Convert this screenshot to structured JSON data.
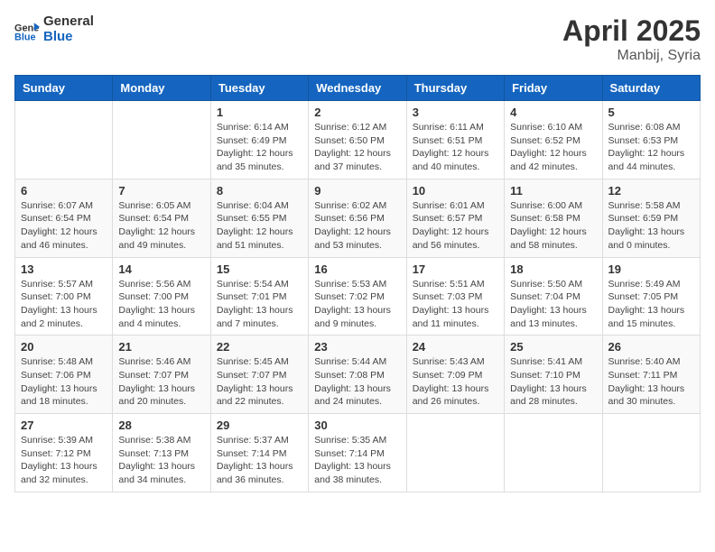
{
  "header": {
    "logo_general": "General",
    "logo_blue": "Blue",
    "title": "April 2025",
    "subtitle": "Manbij, Syria"
  },
  "calendar": {
    "days_of_week": [
      "Sunday",
      "Monday",
      "Tuesday",
      "Wednesday",
      "Thursday",
      "Friday",
      "Saturday"
    ],
    "weeks": [
      [
        {
          "day": "",
          "content": ""
        },
        {
          "day": "",
          "content": ""
        },
        {
          "day": "1",
          "content": "Sunrise: 6:14 AM\nSunset: 6:49 PM\nDaylight: 12 hours and 35 minutes."
        },
        {
          "day": "2",
          "content": "Sunrise: 6:12 AM\nSunset: 6:50 PM\nDaylight: 12 hours and 37 minutes."
        },
        {
          "day": "3",
          "content": "Sunrise: 6:11 AM\nSunset: 6:51 PM\nDaylight: 12 hours and 40 minutes."
        },
        {
          "day": "4",
          "content": "Sunrise: 6:10 AM\nSunset: 6:52 PM\nDaylight: 12 hours and 42 minutes."
        },
        {
          "day": "5",
          "content": "Sunrise: 6:08 AM\nSunset: 6:53 PM\nDaylight: 12 hours and 44 minutes."
        }
      ],
      [
        {
          "day": "6",
          "content": "Sunrise: 6:07 AM\nSunset: 6:54 PM\nDaylight: 12 hours and 46 minutes."
        },
        {
          "day": "7",
          "content": "Sunrise: 6:05 AM\nSunset: 6:54 PM\nDaylight: 12 hours and 49 minutes."
        },
        {
          "day": "8",
          "content": "Sunrise: 6:04 AM\nSunset: 6:55 PM\nDaylight: 12 hours and 51 minutes."
        },
        {
          "day": "9",
          "content": "Sunrise: 6:02 AM\nSunset: 6:56 PM\nDaylight: 12 hours and 53 minutes."
        },
        {
          "day": "10",
          "content": "Sunrise: 6:01 AM\nSunset: 6:57 PM\nDaylight: 12 hours and 56 minutes."
        },
        {
          "day": "11",
          "content": "Sunrise: 6:00 AM\nSunset: 6:58 PM\nDaylight: 12 hours and 58 minutes."
        },
        {
          "day": "12",
          "content": "Sunrise: 5:58 AM\nSunset: 6:59 PM\nDaylight: 13 hours and 0 minutes."
        }
      ],
      [
        {
          "day": "13",
          "content": "Sunrise: 5:57 AM\nSunset: 7:00 PM\nDaylight: 13 hours and 2 minutes."
        },
        {
          "day": "14",
          "content": "Sunrise: 5:56 AM\nSunset: 7:00 PM\nDaylight: 13 hours and 4 minutes."
        },
        {
          "day": "15",
          "content": "Sunrise: 5:54 AM\nSunset: 7:01 PM\nDaylight: 13 hours and 7 minutes."
        },
        {
          "day": "16",
          "content": "Sunrise: 5:53 AM\nSunset: 7:02 PM\nDaylight: 13 hours and 9 minutes."
        },
        {
          "day": "17",
          "content": "Sunrise: 5:51 AM\nSunset: 7:03 PM\nDaylight: 13 hours and 11 minutes."
        },
        {
          "day": "18",
          "content": "Sunrise: 5:50 AM\nSunset: 7:04 PM\nDaylight: 13 hours and 13 minutes."
        },
        {
          "day": "19",
          "content": "Sunrise: 5:49 AM\nSunset: 7:05 PM\nDaylight: 13 hours and 15 minutes."
        }
      ],
      [
        {
          "day": "20",
          "content": "Sunrise: 5:48 AM\nSunset: 7:06 PM\nDaylight: 13 hours and 18 minutes."
        },
        {
          "day": "21",
          "content": "Sunrise: 5:46 AM\nSunset: 7:07 PM\nDaylight: 13 hours and 20 minutes."
        },
        {
          "day": "22",
          "content": "Sunrise: 5:45 AM\nSunset: 7:07 PM\nDaylight: 13 hours and 22 minutes."
        },
        {
          "day": "23",
          "content": "Sunrise: 5:44 AM\nSunset: 7:08 PM\nDaylight: 13 hours and 24 minutes."
        },
        {
          "day": "24",
          "content": "Sunrise: 5:43 AM\nSunset: 7:09 PM\nDaylight: 13 hours and 26 minutes."
        },
        {
          "day": "25",
          "content": "Sunrise: 5:41 AM\nSunset: 7:10 PM\nDaylight: 13 hours and 28 minutes."
        },
        {
          "day": "26",
          "content": "Sunrise: 5:40 AM\nSunset: 7:11 PM\nDaylight: 13 hours and 30 minutes."
        }
      ],
      [
        {
          "day": "27",
          "content": "Sunrise: 5:39 AM\nSunset: 7:12 PM\nDaylight: 13 hours and 32 minutes."
        },
        {
          "day": "28",
          "content": "Sunrise: 5:38 AM\nSunset: 7:13 PM\nDaylight: 13 hours and 34 minutes."
        },
        {
          "day": "29",
          "content": "Sunrise: 5:37 AM\nSunset: 7:14 PM\nDaylight: 13 hours and 36 minutes."
        },
        {
          "day": "30",
          "content": "Sunrise: 5:35 AM\nSunset: 7:14 PM\nDaylight: 13 hours and 38 minutes."
        },
        {
          "day": "",
          "content": ""
        },
        {
          "day": "",
          "content": ""
        },
        {
          "day": "",
          "content": ""
        }
      ]
    ]
  }
}
